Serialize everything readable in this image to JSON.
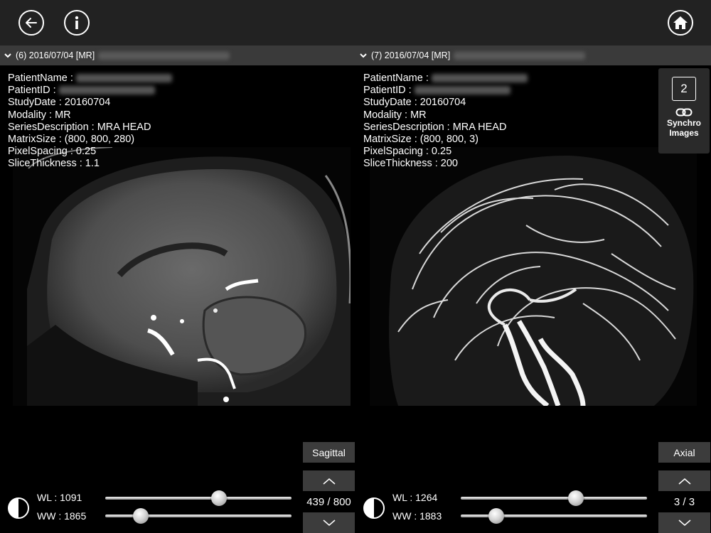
{
  "topbar": {
    "back_icon": "arrow-left-circle-icon",
    "info_icon": "info-circle-icon",
    "home_icon": "home-circle-icon"
  },
  "panels": [
    {
      "header": "(6) 2016/07/04 [MR]",
      "info": {
        "patient_name_label": "PatientName :",
        "patient_id_label": "PatientID :",
        "study_date": "StudyDate : 20160704",
        "modality": "Modality : MR",
        "series_description": "SeriesDescription : MRA HEAD",
        "matrix_size": "MatrixSize : (800, 800, 280)",
        "pixel_spacing": "PixelSpacing : 0.25",
        "slice_thickness": "SliceThickness : 1.1"
      },
      "orientation": "Sagittal",
      "slice_counter": "439 / 800",
      "wl_label": "WL : 1091",
      "ww_label": "WW : 1865",
      "wl_fraction": 0.61,
      "ww_fraction": 0.19
    },
    {
      "header": "(7) 2016/07/04 [MR]",
      "info": {
        "patient_name_label": "PatientName :",
        "patient_id_label": "PatientID :",
        "study_date": "StudyDate : 20160704",
        "modality": "Modality : MR",
        "series_description": "SeriesDescription : MRA HEAD",
        "matrix_size": "MatrixSize : (800, 800, 3)",
        "pixel_spacing": "PixelSpacing : 0.25",
        "slice_thickness": "SliceThickness : 200"
      },
      "orientation": "Axial",
      "slice_counter": "3 / 3",
      "wl_label": "WL : 1264",
      "ww_label": "WW : 1883",
      "wl_fraction": 0.62,
      "ww_fraction": 0.19
    }
  ],
  "synchro": {
    "count": "2",
    "label_line1": "Synchro",
    "label_line2": "Images",
    "icon": "link-icon"
  }
}
